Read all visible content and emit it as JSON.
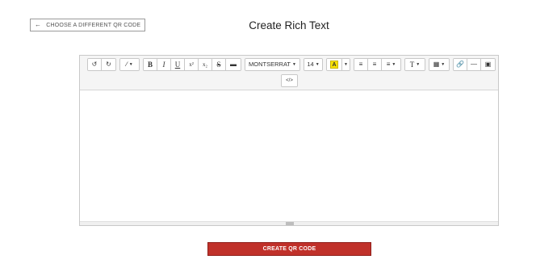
{
  "header": {
    "back_label": "CHOOSE A DIFFERENT QR CODE",
    "title": "Create Rich Text"
  },
  "toolbar": {
    "font_name": "MONTSERRAT",
    "font_size": "14",
    "bold": "B",
    "italic": "I",
    "underline": "U",
    "superscript": "x²",
    "subscript": "x₂",
    "strikethrough": "S",
    "highlight_letter": "A",
    "style_label": "T",
    "code_view": "</>"
  },
  "actions": {
    "create_label": "CREATE QR CODE"
  },
  "colors": {
    "accent": "#c0312a",
    "highlight": "#f7e100"
  }
}
